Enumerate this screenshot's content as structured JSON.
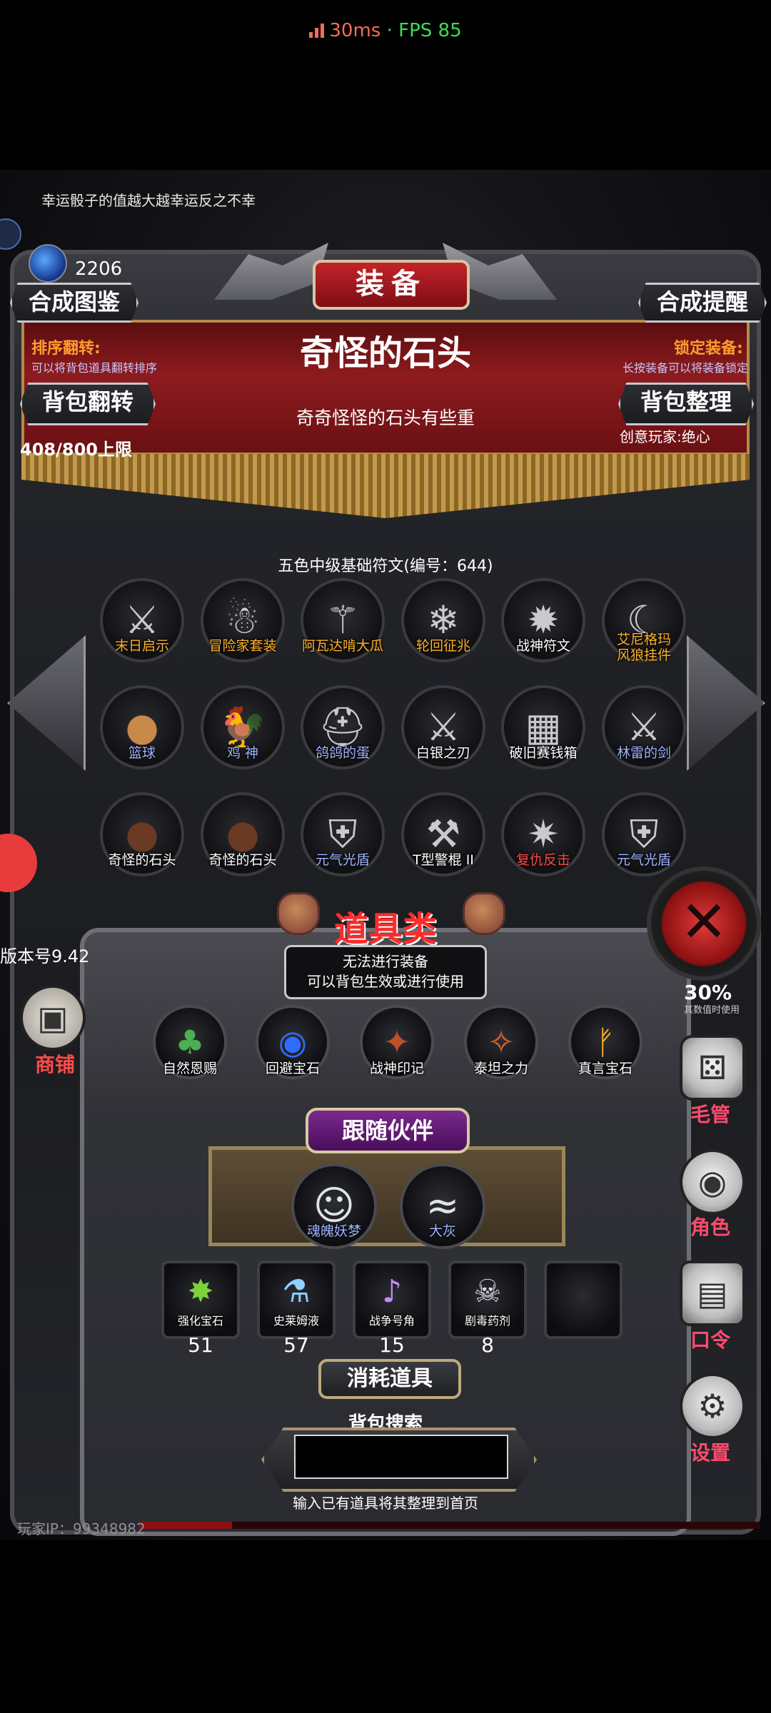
{
  "status": {
    "ping": "30ms",
    "separator": " · ",
    "fps": "FPS 85"
  },
  "tip": "幸运骰子的值越大越幸运反之不幸",
  "gems": {
    "count": "2206",
    "icon": "blue-crystal-icon"
  },
  "header": {
    "title": "装备",
    "left_top_button": "合成图鉴",
    "right_top_button": "合成提醒",
    "sort_flip_label": "排序翻转:",
    "sort_flip_desc": "可以将背包道具翻转排序",
    "lock_label": "锁定装备:",
    "lock_desc": "长按装备可以将装备锁定",
    "flip_button": "背包翻转",
    "arrange_button": "背包整理",
    "capacity": "408/800上限",
    "creator": "创意玩家:绝心"
  },
  "selected_item": {
    "name": "奇怪的石头",
    "description": "奇奇怪怪的石头有些重"
  },
  "grid_caption": "五色中级基础符文(编号：644)",
  "inventory": [
    {
      "label": "末日启示",
      "color": "orange",
      "icon": "battle-axe-icon"
    },
    {
      "label": "冒险家套装",
      "color": "orange",
      "icon": "adventurer-icon"
    },
    {
      "label": "阿瓦达啃大瓜",
      "color": "orange",
      "icon": "staff-icon"
    },
    {
      "label": "轮回征兆",
      "color": "orange",
      "icon": "ice-staff-icon"
    },
    {
      "label": "战神符文",
      "color": "white",
      "icon": "rune-icon"
    },
    {
      "label": "艾尼格玛\n风狼挂件",
      "color": "orange",
      "icon": "wolf-pendant-icon"
    },
    {
      "label": "篮球",
      "color": "blue",
      "icon": "basketball-icon"
    },
    {
      "label": "鸡 神",
      "color": "blue",
      "icon": "chicken-icon"
    },
    {
      "label": "鸽鸽的蛋",
      "color": "blue",
      "icon": "helmet-icon"
    },
    {
      "label": "白银之刃",
      "color": "white",
      "icon": "sword-icon"
    },
    {
      "label": "破旧赛钱箱",
      "color": "white",
      "icon": "chest-icon"
    },
    {
      "label": "林雷的剑",
      "color": "blue",
      "icon": "blue-sword-icon"
    },
    {
      "label": "奇怪的石头",
      "color": "white",
      "icon": "stone-icon"
    },
    {
      "label": "奇怪的石头",
      "color": "white",
      "icon": "stone-icon"
    },
    {
      "label": "元气光盾",
      "color": "blue",
      "icon": "shield-icon"
    },
    {
      "label": "T型警棍 II",
      "color": "white",
      "icon": "baton-icon"
    },
    {
      "label": "复仇反击",
      "color": "red",
      "icon": "spiked-armor-icon"
    },
    {
      "label": "元气光盾",
      "color": "blue",
      "icon": "shield-icon"
    }
  ],
  "props_section": {
    "title": "道具类",
    "info_line1": "无法进行装备",
    "info_line2": "可以背包生效或进行使用",
    "items": [
      {
        "label": "自然恩赐",
        "icon": "leaf-icon"
      },
      {
        "label": "回避宝石",
        "icon": "blue-gem-icon"
      },
      {
        "label": "战神印记",
        "icon": "mark-icon"
      },
      {
        "label": "泰坦之力",
        "icon": "titan-icon"
      },
      {
        "label": "真言宝石",
        "icon": "rune-gem-icon"
      }
    ]
  },
  "companions": {
    "title": "跟随伙伴",
    "items": [
      {
        "label": "魂魄妖梦",
        "icon": "youmu-icon"
      },
      {
        "label": "大灰",
        "icon": "dolphin-icon"
      }
    ]
  },
  "consumables": {
    "title": "消耗道具",
    "items": [
      {
        "label": "强化宝石",
        "count": "51",
        "icon": "green-gem-icon"
      },
      {
        "label": "史莱姆液",
        "count": "57",
        "icon": "potion-icon"
      },
      {
        "label": "战争号角",
        "count": "15",
        "icon": "horn-icon"
      },
      {
        "label": "剧毒药剂",
        "count": "8",
        "icon": "poison-icon"
      }
    ]
  },
  "search": {
    "title": "背包搜索",
    "value": "",
    "hint": "输入已有道具将其整理到首页"
  },
  "player_ip": "玩家IP：99348982",
  "version": "版本号9.42",
  "side": {
    "shop": "商铺",
    "manage": "毛管",
    "role": "角色",
    "command": "口令",
    "settings": "设置",
    "pct": "30%",
    "pct_sub": "其数值时使用"
  }
}
